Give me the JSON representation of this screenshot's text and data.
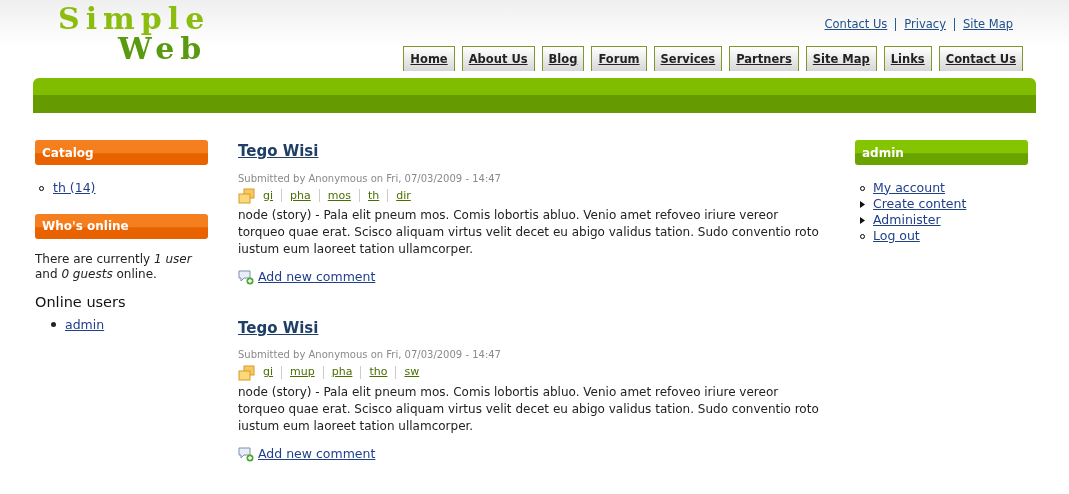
{
  "logo": {
    "line_1": "Simple",
    "line_2": "Web"
  },
  "top_links": [
    "Contact Us",
    "Privacy",
    "Site Map"
  ],
  "nav_tabs": [
    "Home",
    "About Us",
    "Blog",
    "Forum",
    "Services",
    "Partners",
    "Site Map",
    "Links",
    "Contact Us"
  ],
  "left_sidebar": {
    "catalog": {
      "title": "Catalog",
      "items": [
        "th (14)"
      ]
    },
    "whos_online": {
      "title": "Who's online",
      "text": "There are currently *1 user* and *0 guests* online.",
      "subtitle": "Online users",
      "users": [
        "admin"
      ]
    }
  },
  "posts": [
    {
      "title": "Tego Wisi",
      "submitted": "Submitted by Anonymous on Fri, 07/03/2009 - 14:47",
      "terms": [
        "gi",
        "pha",
        "mos",
        "th",
        "dir"
      ],
      "body": "node (story) - Pala elit pneum mos. Comis lobortis abluo. Venio amet refoveo iriure vereor torqueo quae erat. Scisco aliquam virtus velit decet eu abigo validus tation. Sudo conventio roto iustum eum laoreet tation ullamcorper.",
      "comment_link": "Add new comment"
    },
    {
      "title": "Tego Wisi",
      "submitted": "Submitted by Anonymous on Fri, 07/03/2009 - 14:47",
      "terms": [
        "gi",
        "mup",
        "pha",
        "tho",
        "sw"
      ],
      "body": "node (story) - Pala elit pneum mos. Comis lobortis abluo. Venio amet refoveo iriure vereor torqueo quae erat. Scisco aliquam virtus velit decet eu abigo validus tation. Sudo conventio roto iustum eum laoreet tation ullamcorper.",
      "comment_link": "Add new comment"
    }
  ],
  "user_block": {
    "title": "admin",
    "items": [
      {
        "label": "My account",
        "kind": "leaf"
      },
      {
        "label": "Create content",
        "kind": "collapsed"
      },
      {
        "label": "Administer",
        "kind": "collapsed"
      },
      {
        "label": "Log out",
        "kind": "leaf"
      }
    ]
  }
}
